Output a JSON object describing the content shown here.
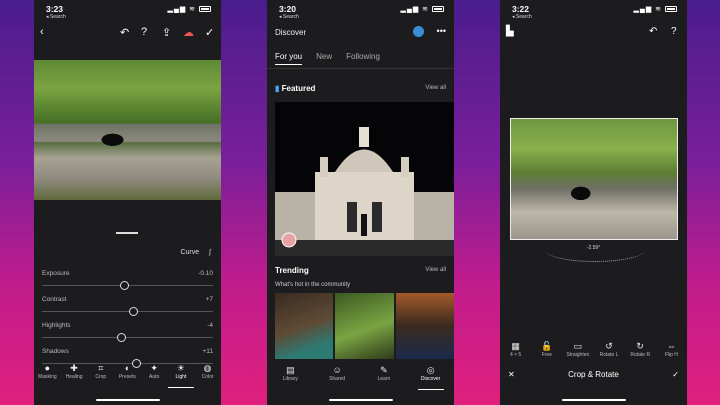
{
  "phone1": {
    "time": "3:23",
    "back": "◂ Search",
    "curve_label": "Curve",
    "sliders": [
      {
        "label": "Exposure",
        "value": "-0.10",
        "level": 0.48
      },
      {
        "label": "Contrast",
        "value": "+7",
        "level": 0.53
      },
      {
        "label": "Highlights",
        "value": "-4",
        "level": 0.46
      },
      {
        "label": "Shadows",
        "value": "+11",
        "level": 0.55
      }
    ],
    "tools": [
      {
        "label": "Masking",
        "icon": "●"
      },
      {
        "label": "Healing",
        "icon": "✚"
      },
      {
        "label": "Crop",
        "icon": "⌗"
      },
      {
        "label": "Presets",
        "icon": "◐"
      },
      {
        "label": "Auto",
        "icon": "✦"
      },
      {
        "label": "Light",
        "icon": "☀"
      },
      {
        "label": "Color",
        "icon": "◍"
      }
    ]
  },
  "phone2": {
    "time": "3:20",
    "back": "◂ Search",
    "title": "Discover",
    "tabs": [
      "For you",
      "New",
      "Following"
    ],
    "featured": "Featured",
    "trending": "Trending",
    "trending_sub": "What's hot in the community",
    "view_all": "View all",
    "nav": [
      {
        "label": "Library",
        "icon": "▤"
      },
      {
        "label": "Shared",
        "icon": "☺"
      },
      {
        "label": "Learn",
        "icon": "✎"
      },
      {
        "label": "Discover",
        "icon": "◎"
      }
    ]
  },
  "phone3": {
    "time": "3:22",
    "back": "◂ Search",
    "angle": "-2.59°",
    "tools": [
      {
        "label": "4 × 5",
        "icon": "▦"
      },
      {
        "label": "Free",
        "icon": "🔓"
      },
      {
        "label": "Straighten",
        "icon": "▭"
      },
      {
        "label": "Rotate L",
        "icon": "↺"
      },
      {
        "label": "Rotate R",
        "icon": "↻"
      },
      {
        "label": "Flip H",
        "icon": "⇔"
      }
    ],
    "footer_title": "Crop & Rotate"
  }
}
